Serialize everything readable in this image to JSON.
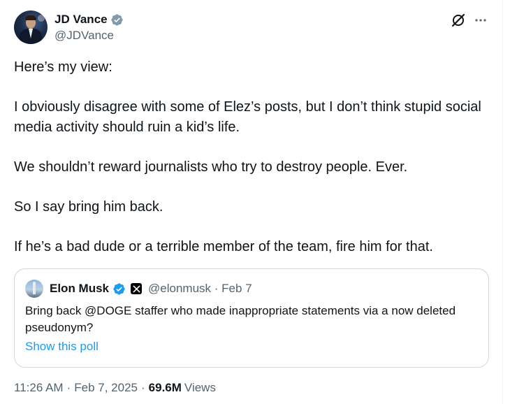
{
  "author": {
    "display_name": "JD Vance",
    "handle": "@JDVance",
    "verified_color": "#829aab"
  },
  "top_icons": [
    "grok-icon",
    "more-options-icon"
  ],
  "tweet": {
    "paragraphs": [
      "Here’s my view:",
      "I obviously disagree with some of Elez’s posts, but I don’t think stupid social media activity should ruin a kid’s life.",
      "We shouldn’t reward journalists who try to destroy people. Ever.",
      "So I say bring him back.",
      "If he’s a bad dude or a terrible member of the team, fire him for that."
    ]
  },
  "quote": {
    "display_name": "Elon Musk",
    "handle": "@elonmusk",
    "date": "Feb 7",
    "separator": "·",
    "text": "Bring back @DOGE staffer who made inappropriate statements via a now deleted pseudonym?",
    "poll_link": "Show this poll",
    "verified_color": "#1d9bf0"
  },
  "meta": {
    "time": "11:26 AM",
    "date": "Feb 7, 2025",
    "separator": "·",
    "views_count": "69.6M",
    "views_label": "Views"
  }
}
